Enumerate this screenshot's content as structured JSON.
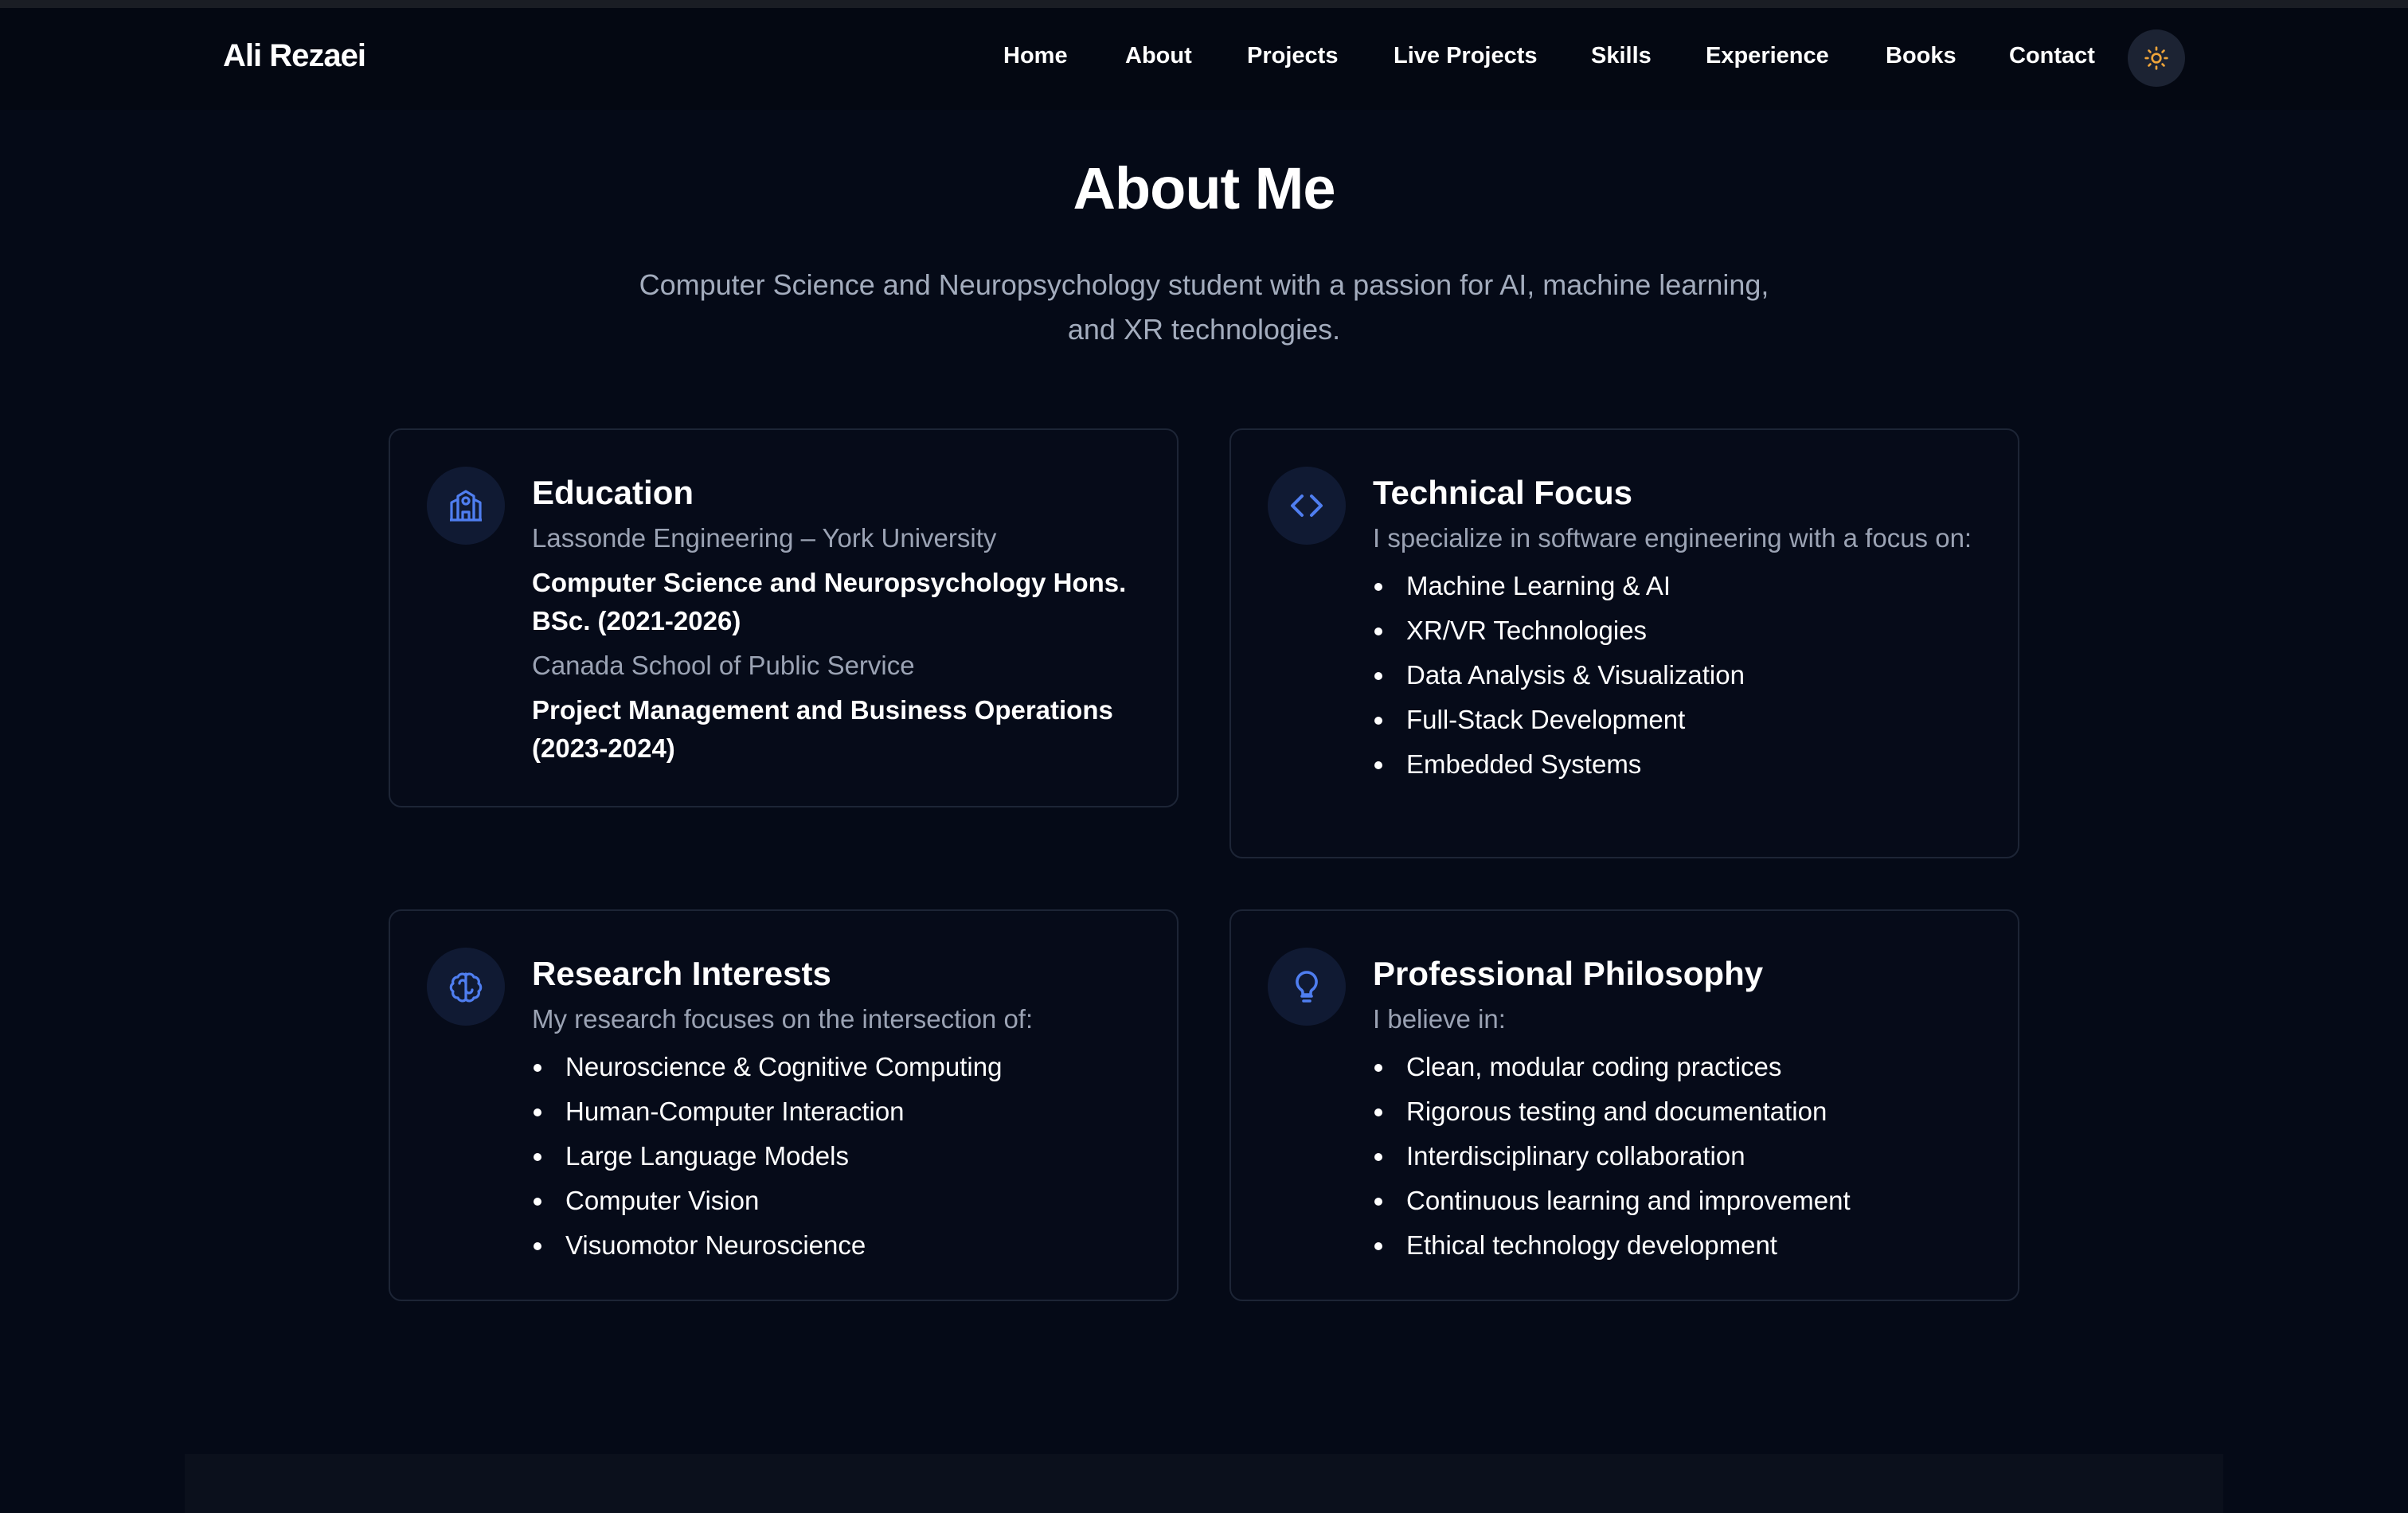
{
  "nav": {
    "brand": "Ali Rezaei",
    "links": [
      "Home",
      "About",
      "Projects",
      "Live Projects",
      "Skills",
      "Experience",
      "Books",
      "Contact"
    ],
    "theme_icon": "sun-icon",
    "accent_color": "#f0a53a"
  },
  "about": {
    "title": "About Me",
    "subtitle": "Computer Science and Neuropsychology student with a passion for AI, machine learning, and XR technologies."
  },
  "cards": {
    "education": {
      "icon": "school-icon",
      "title": "Education",
      "items": [
        {
          "org": "Lassonde Engineering – York University",
          "program": "Computer Science and Neuropsychology Hons. BSc. (2021-2026)"
        },
        {
          "org": "Canada School of Public Service",
          "program": "Project Management and Business Operations (2023-2024)"
        }
      ]
    },
    "technical": {
      "icon": "code-icon",
      "title": "Technical Focus",
      "intro": "I specialize in software engineering with a focus on:",
      "bullets": [
        "Machine Learning & AI",
        "XR/VR Technologies",
        "Data Analysis & Visualization",
        "Full-Stack Development",
        "Embedded Systems"
      ]
    },
    "research": {
      "icon": "brain-icon",
      "title": "Research Interests",
      "intro": "My research focuses on the intersection of:",
      "bullets": [
        "Neuroscience & Cognitive Computing",
        "Human-Computer Interaction",
        "Large Language Models",
        "Computer Vision",
        "Visuomotor Neuroscience"
      ]
    },
    "philosophy": {
      "icon": "lightbulb-icon",
      "title": "Professional Philosophy",
      "intro": "I believe in:",
      "bullets": [
        "Clean, modular coding practices",
        "Rigorous testing and documentation",
        "Interdisciplinary collaboration",
        "Continuous learning and improvement",
        "Ethical technology development"
      ]
    }
  },
  "colors": {
    "background": "#050a17",
    "icon_blue": "#4f7ef0",
    "muted_text": "#9ba3b4"
  }
}
